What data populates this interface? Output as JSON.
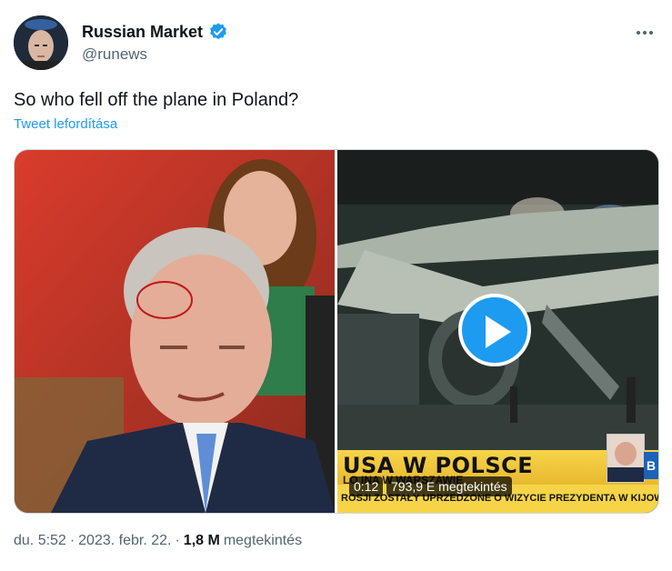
{
  "author": {
    "display_name": "Russian Market",
    "handle": "@runews",
    "verified_icon": "verified-badge-icon",
    "verified_color": "#1d9bf0"
  },
  "tweet": {
    "text": "So who fell off the plane in Poland?",
    "translate_label": "Tweet lefordítása"
  },
  "media": {
    "video": {
      "headline": "USA W POLSCE",
      "subline": "LO                  INA W WARSZAWIE",
      "ticker": "ROSJI ZOSTAŁY UPRZEDZONE O WIZYCIE PREZYDENTA W KIJOWIE",
      "duration": "0:12",
      "views_label": "793,9 E megtekintés",
      "logo_text": "B"
    }
  },
  "meta": {
    "time": "du. 5:52",
    "sep1": "·",
    "date": "2023. febr. 22.",
    "sep2": "·",
    "views_count": "1,8 M",
    "views_label": "megtekintés"
  },
  "colors": {
    "accent": "#1d9bf0",
    "text": "#0f1419",
    "secondary": "#536471",
    "banner": "#f6d447"
  }
}
